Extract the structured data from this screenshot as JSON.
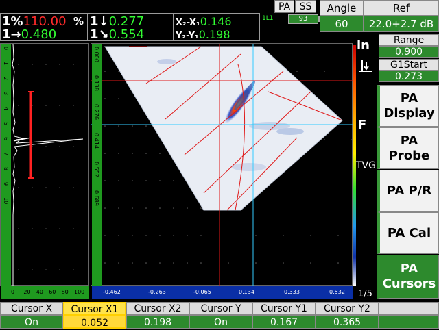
{
  "readouts": {
    "a_label": "1%",
    "a_value": "110.00",
    "a_unit": "%",
    "b_label": "1→",
    "b_value": "0.480",
    "c_label": "1↓",
    "c_value": "0.277",
    "d_label": "1↘",
    "d_value": "0.554",
    "e_label": "X₂-X₁",
    "e_value": "0.146",
    "f_label": "Y₂-Y₁",
    "f_value": "0.198"
  },
  "status": {
    "channel": "1L1",
    "battery": "93"
  },
  "tabs": {
    "pa": "PA",
    "ss": "SS"
  },
  "params": {
    "angle_label": "Angle",
    "angle_value": "60",
    "ref_label": "Ref",
    "ref_value": "22.0+2.7 dB",
    "range_label": "Range",
    "range_value": "0.900",
    "g1start_label": "G1Start",
    "g1start_value": "0.273"
  },
  "unit_indicator": "in",
  "tvg_label": "TVG",
  "f_label": "F",
  "page_indicator": "1/5",
  "menu": [
    {
      "label": "PA Display"
    },
    {
      "label": "PA Probe"
    },
    {
      "label": "PA P/R"
    },
    {
      "label": "PA Cal"
    },
    {
      "label": "PA Cursors",
      "active": true
    }
  ],
  "bottom": [
    {
      "label": "Cursor X",
      "value": "On"
    },
    {
      "label": "Cursor X1",
      "value": "0.052",
      "selected": true
    },
    {
      "label": "Cursor X2",
      "value": "0.198"
    },
    {
      "label": "Cursor Y",
      "value": "On"
    },
    {
      "label": "Cursor Y1",
      "value": "0.167"
    },
    {
      "label": "Cursor Y2",
      "value": "0.365"
    }
  ],
  "ascan_ruler_v": [
    "0",
    "1",
    "2",
    "3",
    "4",
    "5",
    "6",
    "7",
    "8",
    "9",
    "10"
  ],
  "ascan_ruler_h": [
    "0",
    "20",
    "40",
    "60",
    "80",
    "100"
  ],
  "sscan_ruler_v": [
    "0.000",
    "0.138",
    "0.276",
    "0.414",
    "0.552",
    "0.689"
  ],
  "sscan_ruler_h": [
    "-0.462",
    "-0.263",
    "-0.065",
    "0.134",
    "0.333",
    "0.532"
  ],
  "colors": {
    "accent": "#2d8a2d",
    "readout": "#33ff33",
    "alarm": "#ff2a2a",
    "cursor": "#33ccff"
  }
}
